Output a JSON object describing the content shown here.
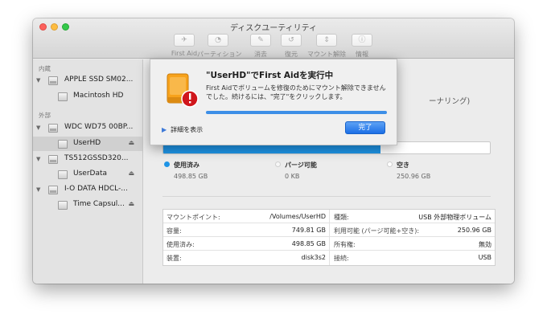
{
  "window": {
    "title": "ディスクユーティリティ"
  },
  "toolbar": [
    {
      "label": "First Aid",
      "icon": "stethoscope-icon",
      "glyph": "✈"
    },
    {
      "label": "パーティション",
      "icon": "partition-icon",
      "glyph": "◔"
    },
    {
      "label": "消去",
      "icon": "erase-icon",
      "glyph": "✎"
    },
    {
      "label": "復元",
      "icon": "restore-icon",
      "glyph": "↺"
    },
    {
      "label": "マウント解除",
      "icon": "unmount-icon",
      "glyph": "⇕"
    },
    {
      "label": "情報",
      "icon": "info-icon",
      "glyph": "ⓘ"
    }
  ],
  "sidebar": {
    "internal_header": "内蔵",
    "external_header": "外部",
    "items": [
      {
        "label": "APPLE SSD SM02...",
        "level": "disk",
        "eject": false
      },
      {
        "label": "Macintosh HD",
        "level": "volume",
        "eject": false
      },
      {
        "label": "WDC WD75 00BP...",
        "level": "disk",
        "eject": false
      },
      {
        "label": "UserHD",
        "level": "volume",
        "eject": true,
        "selected": true
      },
      {
        "label": "TS512GSSD320...",
        "level": "disk",
        "eject": false
      },
      {
        "label": "UserData",
        "level": "volume",
        "eject": true
      },
      {
        "label": "I-O DATA HDCL-...",
        "level": "disk",
        "eject": false
      },
      {
        "label": "Time Capsul...",
        "level": "volume",
        "eject": true
      }
    ],
    "eject_glyph": "⏏",
    "disclosure_glyph": "▼"
  },
  "main": {
    "partial_text": "ーナリング)",
    "capacity_used_fraction": 0.665,
    "legend": [
      {
        "name": "使用済み",
        "value": "498.85 GB",
        "color": "#1e94e6"
      },
      {
        "name": "パージ可能",
        "value": "0 KB",
        "color": "#f4f4f4"
      },
      {
        "name": "空き",
        "value": "250.96 GB",
        "color": "#ffffff"
      }
    ],
    "info": {
      "left": [
        {
          "key": "マウントポイント:",
          "value": "/Volumes/UserHD"
        },
        {
          "key": "容量:",
          "value": "749.81 GB"
        },
        {
          "key": "使用済み:",
          "value": "498.85 GB"
        },
        {
          "key": "装置:",
          "value": "disk3s2"
        }
      ],
      "right": [
        {
          "key": "種類:",
          "value": "USB 外部物理ボリューム"
        },
        {
          "key": "利用可能 (パージ可能+空き):",
          "value": "250.96 GB"
        },
        {
          "key": "所有権:",
          "value": "無効"
        },
        {
          "key": "接続:",
          "value": "USB"
        }
      ]
    }
  },
  "sheet": {
    "title": "\"UserHD\"でFirst Aidを実行中",
    "message": "First Aidでボリュームを修復のためにマウント解除できませんでした。続けるには、\"完了\"をクリックします。",
    "progress": 1.0,
    "details_label": "詳細を表示",
    "details_glyph": "▶",
    "done_label": "完了",
    "icon": "external-disk-warning-icon"
  }
}
